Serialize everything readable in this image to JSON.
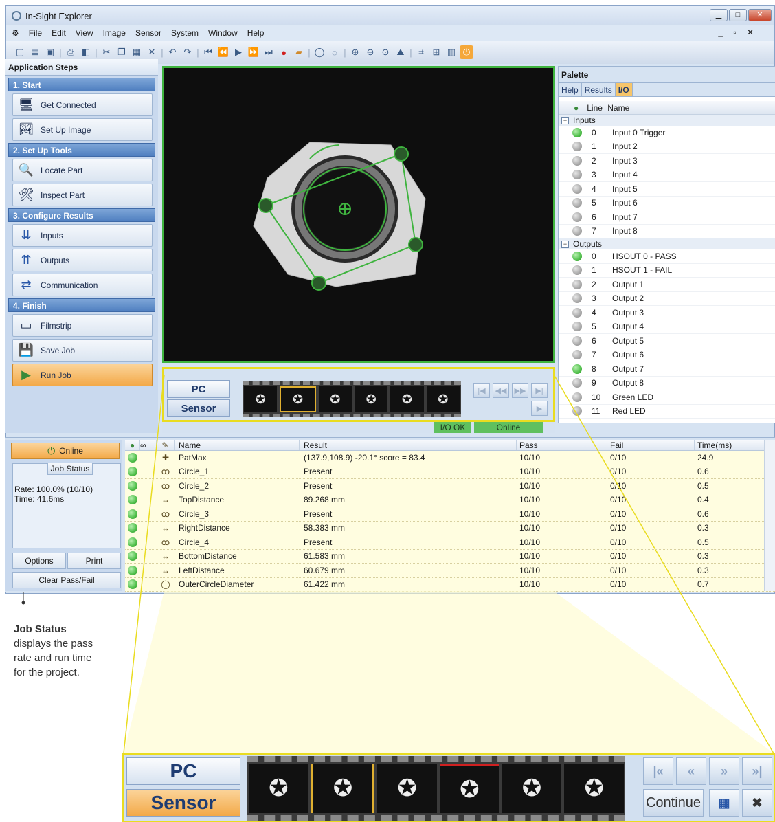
{
  "window": {
    "title": "In-Sight Explorer"
  },
  "menu": [
    "File",
    "Edit",
    "View",
    "Image",
    "Sensor",
    "System",
    "Window",
    "Help"
  ],
  "app_steps": {
    "title": "Application Steps",
    "sections": [
      {
        "label": "1. Start",
        "items": [
          "Get Connected",
          "Set Up Image"
        ]
      },
      {
        "label": "2. Set Up Tools",
        "items": [
          "Locate Part",
          "Inspect Part"
        ]
      },
      {
        "label": "3. Configure Results",
        "items": [
          "Inputs",
          "Outputs",
          "Communication"
        ]
      },
      {
        "label": "4. Finish",
        "items": [
          "Filmstrip",
          "Save Job",
          "Run Job"
        ]
      }
    ]
  },
  "film": {
    "pc": "PC",
    "sensor": "Sensor",
    "continue": "Continue"
  },
  "status": {
    "io": "I/O OK",
    "online": "Online"
  },
  "palette": {
    "title": "Palette",
    "tabs": [
      "Help",
      "Results",
      "I/O"
    ],
    "columns": [
      "Line",
      "Name"
    ],
    "inputs_label": "Inputs",
    "inputs": [
      {
        "line": "0",
        "name": "Input 0 Trigger",
        "on": true
      },
      {
        "line": "1",
        "name": "Input 2",
        "on": false
      },
      {
        "line": "2",
        "name": "Input 3",
        "on": false
      },
      {
        "line": "3",
        "name": "Input 4",
        "on": false
      },
      {
        "line": "4",
        "name": "Input 5",
        "on": false
      },
      {
        "line": "5",
        "name": "Input 6",
        "on": false
      },
      {
        "line": "6",
        "name": "Input 7",
        "on": false
      },
      {
        "line": "7",
        "name": "Input 8",
        "on": false
      }
    ],
    "outputs_label": "Outputs",
    "outputs": [
      {
        "line": "0",
        "name": "HSOUT 0 - PASS",
        "on": true
      },
      {
        "line": "1",
        "name": "HSOUT 1 - FAIL",
        "on": false
      },
      {
        "line": "2",
        "name": "Output 1",
        "on": false
      },
      {
        "line": "3",
        "name": "Output 2",
        "on": false
      },
      {
        "line": "4",
        "name": "Output 3",
        "on": false
      },
      {
        "line": "5",
        "name": "Output 4",
        "on": false
      },
      {
        "line": "6",
        "name": "Output 5",
        "on": false
      },
      {
        "line": "7",
        "name": "Output 6",
        "on": false
      },
      {
        "line": "8",
        "name": "Output 7",
        "on": true
      },
      {
        "line": "9",
        "name": "Output 8",
        "on": false
      },
      {
        "line": "10",
        "name": "Green LED",
        "on": false
      },
      {
        "line": "11",
        "name": "Red LED",
        "on": false
      }
    ]
  },
  "job": {
    "online": "Online",
    "status_title": "Job Status",
    "rate": "Rate: 100.0% (10/10)",
    "time": "Time: 41.6ms",
    "options": "Options",
    "print": "Print",
    "clear": "Clear Pass/Fail"
  },
  "results": {
    "columns": [
      "Name",
      "Result",
      "Pass",
      "Fail",
      "Time(ms)"
    ],
    "rows": [
      {
        "icon": "✚",
        "name": "PatMax",
        "result": "(137.9,108.9) -20.1° score = 83.4",
        "pass": "10/10",
        "fail": "0/10",
        "time": "24.9"
      },
      {
        "icon": "ꝏ",
        "name": "Circle_1",
        "result": "Present",
        "pass": "10/10",
        "fail": "0/10",
        "time": "0.6"
      },
      {
        "icon": "ꝏ",
        "name": "Circle_2",
        "result": "Present",
        "pass": "10/10",
        "fail": "0/10",
        "time": "0.5"
      },
      {
        "icon": "↔",
        "name": "TopDistance",
        "result": "89.268 mm",
        "pass": "10/10",
        "fail": "0/10",
        "time": "0.4"
      },
      {
        "icon": "ꝏ",
        "name": "Circle_3",
        "result": "Present",
        "pass": "10/10",
        "fail": "0/10",
        "time": "0.6"
      },
      {
        "icon": "↔",
        "name": "RightDistance",
        "result": "58.383 mm",
        "pass": "10/10",
        "fail": "0/10",
        "time": "0.3"
      },
      {
        "icon": "ꝏ",
        "name": "Circle_4",
        "result": "Present",
        "pass": "10/10",
        "fail": "0/10",
        "time": "0.5"
      },
      {
        "icon": "↔",
        "name": "BottomDistance",
        "result": "61.583 mm",
        "pass": "10/10",
        "fail": "0/10",
        "time": "0.3"
      },
      {
        "icon": "↔",
        "name": "LeftDistance",
        "result": "60.679 mm",
        "pass": "10/10",
        "fail": "0/10",
        "time": "0.3"
      },
      {
        "icon": "◯",
        "name": "OuterCircleDiameter",
        "result": "61.422 mm",
        "pass": "10/10",
        "fail": "0/10",
        "time": "0.7"
      }
    ]
  },
  "callout": {
    "title": "Job Status",
    "body": "displays the pass rate and run time for the project."
  },
  "colors": {
    "accent": "#f3a948",
    "green": "#3fb43f",
    "highlight": "#e9dc20"
  }
}
